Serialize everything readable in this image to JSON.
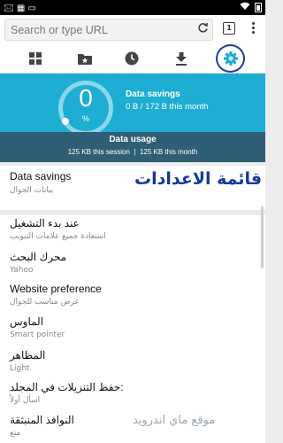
{
  "status_bar": {
    "left": "🖂 ▦ ▭",
    "wifi_icon": "wifi-icon",
    "battery_icon": "battery-icon"
  },
  "toolbar": {
    "url_placeholder": "Search or type URL",
    "reload_icon": "reload-icon",
    "tab_count": "1",
    "menu_icon": "more-vert-icon"
  },
  "icon_bar": {
    "items": [
      {
        "name": "grid-icon"
      },
      {
        "name": "bookmarks-folder-icon"
      },
      {
        "name": "history-clock-icon"
      },
      {
        "name": "download-icon"
      },
      {
        "name": "settings-gear-icon",
        "highlighted": true
      }
    ],
    "accent": "#1eaed3",
    "highlight_ring": "#1a3f9e"
  },
  "savings_panel": {
    "percent_value": "0",
    "percent_symbol": "%",
    "title": "Data savings",
    "value": "0 B / 172 B this month",
    "usage_title": "Data usage",
    "usage_session": "125 KB this session",
    "usage_separator": "|",
    "usage_month": "125 KB this month"
  },
  "overlay_title": "قائمة الاعدادات",
  "settings": [
    {
      "title": "Data savings",
      "subtitle": "بيانات الجوال"
    },
    {
      "title": "عند بدء التشغيل",
      "subtitle": "استعادة جميع علامات التبويب"
    },
    {
      "title": "محرك البحث",
      "subtitle": "Yahoo"
    },
    {
      "title": "Website preference",
      "subtitle": "عرض مناسب للجوال"
    },
    {
      "title": "الماوس",
      "subtitle": "Smart pointer"
    },
    {
      "title": "المظاهر",
      "subtitle": "Light"
    },
    {
      "title": "حفظ التنزيلات في المجلد:",
      "subtitle": "اسأل أولاً"
    },
    {
      "title": "النوافذ المنبثقة",
      "subtitle": "منع"
    }
  ],
  "watermark": "موقع ماي اندرويد"
}
